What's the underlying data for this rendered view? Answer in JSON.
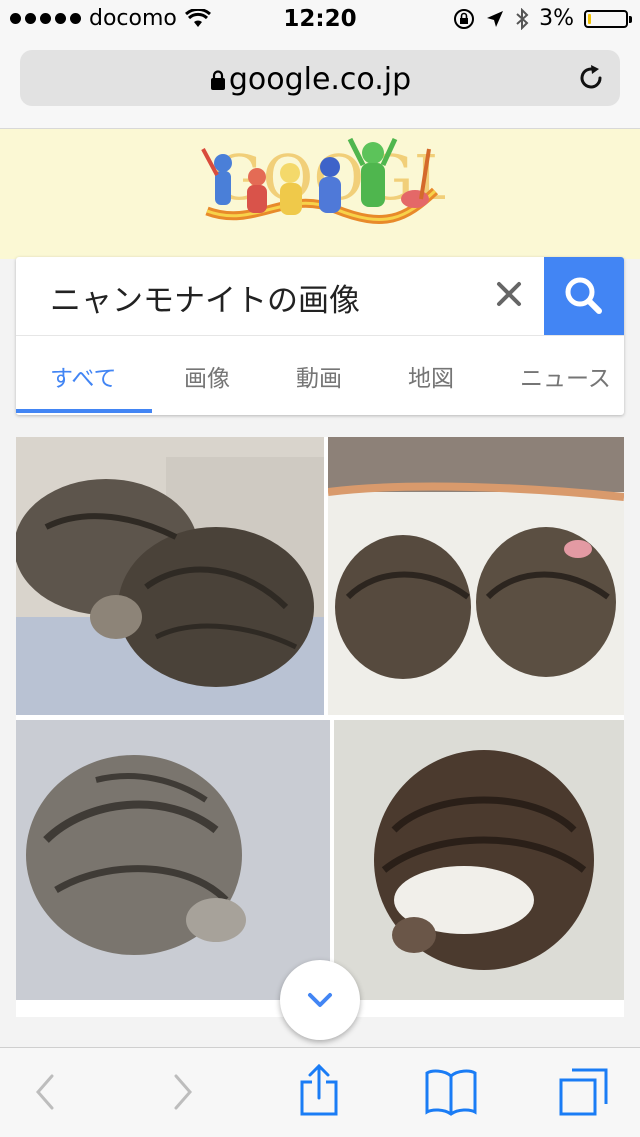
{
  "status_bar": {
    "carrier": "docomo",
    "time": "12:20",
    "battery_percent": "3%",
    "battery_level": 0.03,
    "battery_color": "#f2c200"
  },
  "browser": {
    "url": "google.co.jp",
    "lock_icon": "lock-icon",
    "reload_icon": "reload-icon"
  },
  "google": {
    "doodle_text": "GOOGLE",
    "hero_color": "#fbf8d4"
  },
  "search": {
    "query": "ニャンモナイトの画像",
    "accent_color": "#4285f4",
    "tabs": [
      {
        "label": "すべて",
        "active": true
      },
      {
        "label": "画像",
        "active": false
      },
      {
        "label": "動画",
        "active": false
      },
      {
        "label": "地図",
        "active": false
      },
      {
        "label": "ニュース",
        "active": false
      }
    ]
  },
  "results": {
    "images": [
      {
        "subject": "two tabby cats curled together"
      },
      {
        "subject": "two tabby cats curled side by side"
      },
      {
        "subject": "silver tabby cat curled up"
      },
      {
        "subject": "brown tabby cat with white belly curled up"
      }
    ]
  },
  "toolbar": {
    "icons": [
      "back-icon",
      "forward-icon",
      "share-icon",
      "bookmarks-icon",
      "tabs-icon"
    ]
  }
}
